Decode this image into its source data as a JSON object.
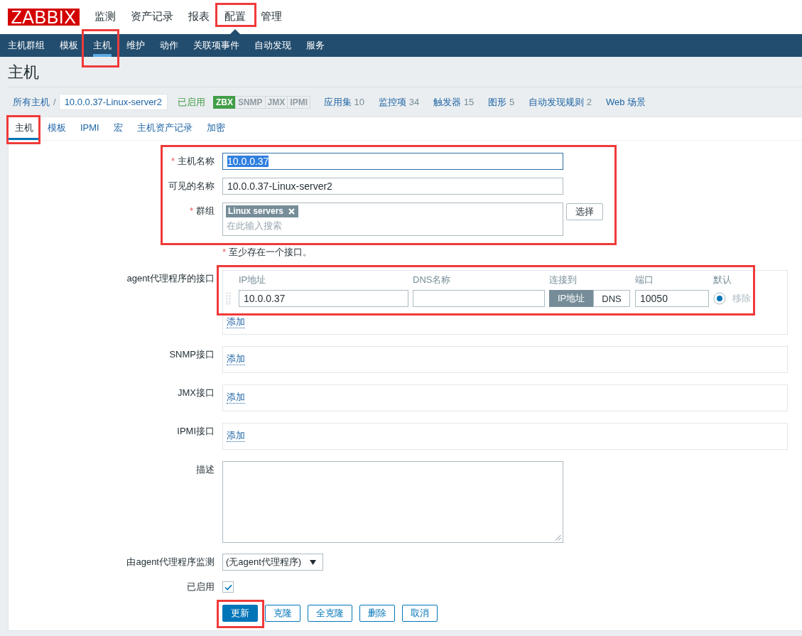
{
  "header": {
    "logo": "ZABBIX",
    "menu": [
      {
        "label": "监测",
        "selected": false,
        "annotated": false
      },
      {
        "label": "资产记录",
        "selected": false,
        "annotated": false
      },
      {
        "label": "报表",
        "selected": false,
        "annotated": false
      },
      {
        "label": "配置",
        "selected": true,
        "annotated": true
      },
      {
        "label": "管理",
        "selected": false,
        "annotated": false
      }
    ]
  },
  "subnav": [
    {
      "label": "主机群组",
      "selected": false,
      "annotated": false
    },
    {
      "label": "模板",
      "selected": false,
      "annotated": false
    },
    {
      "label": "主机",
      "selected": true,
      "annotated": true
    },
    {
      "label": "维护",
      "selected": false,
      "annotated": false
    },
    {
      "label": "动作",
      "selected": false,
      "annotated": false
    },
    {
      "label": "关联项事件",
      "selected": false,
      "annotated": false
    },
    {
      "label": "自动发现",
      "selected": false,
      "annotated": false
    },
    {
      "label": "服务",
      "selected": false,
      "annotated": false
    }
  ],
  "page_title": "主机",
  "breadcrumb": {
    "root": "所有主机",
    "separator": "/",
    "current": "10.0.0.37-Linux-server2",
    "status": {
      "label": "已启用",
      "enabled": true
    },
    "availability": [
      {
        "label": "ZBX",
        "available": true
      },
      {
        "label": "SNMP",
        "available": false
      },
      {
        "label": "JMX",
        "available": false
      },
      {
        "label": "IPMI",
        "available": false
      }
    ],
    "links": [
      {
        "label": "应用集",
        "count": "10"
      },
      {
        "label": "监控项",
        "count": "34"
      },
      {
        "label": "触发器",
        "count": "15"
      },
      {
        "label": "图形",
        "count": "5"
      },
      {
        "label": "自动发现规则",
        "count": "2"
      },
      {
        "label": "Web 场景"
      }
    ]
  },
  "tabs": [
    {
      "label": "主机",
      "selected": true,
      "annotated": true
    },
    {
      "label": "模板",
      "selected": false,
      "annotated": false
    },
    {
      "label": "IPMI",
      "selected": false,
      "annotated": false
    },
    {
      "label": "宏",
      "selected": false,
      "annotated": false
    },
    {
      "label": "主机资产记录",
      "selected": false,
      "annotated": false
    },
    {
      "label": "加密",
      "selected": false,
      "annotated": false
    }
  ],
  "form": {
    "host_block": {
      "annotated": true,
      "fields": [
        {
          "kind": "text",
          "label": "主机名称",
          "required_mark": "*",
          "value": "10.0.0.37",
          "focused": true
        },
        {
          "kind": "text",
          "label": "可见的名称",
          "value": "10.0.0.37-Linux-server2",
          "focused": false
        },
        {
          "kind": "multiselect",
          "label": "群组",
          "required_mark": "*",
          "tags": [
            "Linux servers"
          ],
          "placeholder": "在此输入搜索",
          "button": "选择"
        }
      ]
    },
    "interface_note": {
      "required_mark": "*",
      "text": "至少存在一个接口。"
    },
    "interfaces": [
      {
        "kind": "table",
        "label": "agent代理程序的接口",
        "annotated": true,
        "columns": [
          "IP地址",
          "DNS名称",
          "连接到",
          "端口",
          "默认"
        ],
        "rows": [
          {
            "ip": "10.0.0.37",
            "connect": [
              {
                "label": "IP地址",
                "selected": true
              },
              {
                "label": "DNS",
                "selected": false
              }
            ],
            "port": "10050",
            "default": true,
            "remove": {
              "label": "移除",
              "disabled": true
            }
          }
        ],
        "add": "添加"
      },
      {
        "kind": "empty",
        "label": "SNMP接口",
        "add": "添加"
      },
      {
        "kind": "empty",
        "label": "JMX接口",
        "add": "添加"
      },
      {
        "kind": "empty",
        "label": "IPMI接口",
        "add": "添加"
      }
    ],
    "description": {
      "label": "描述"
    },
    "proxy": {
      "label": "由agent代理程序监测",
      "value": "(无agent代理程序)"
    },
    "enabled": {
      "label": "已启用",
      "checked": true
    },
    "buttons": [
      {
        "label": "更新",
        "primary": true,
        "annotated": true
      },
      {
        "label": "克隆",
        "primary": false,
        "annotated": false
      },
      {
        "label": "全克隆",
        "primary": false,
        "annotated": false
      },
      {
        "label": "删除",
        "primary": false,
        "annotated": false
      },
      {
        "label": "取消",
        "primary": false,
        "annotated": false
      }
    ]
  }
}
